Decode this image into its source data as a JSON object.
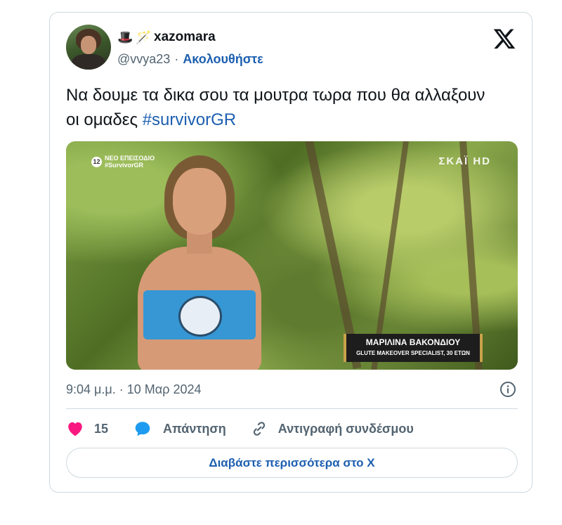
{
  "author": {
    "emoji_1": "🎩",
    "emoji_2": "🪄",
    "display_name": "xazomara",
    "handle": "@vvya23",
    "separator": "·",
    "follow_label": "Ακολουθήστε"
  },
  "tweet": {
    "text": "Να δουμε τα δικα σου τα μουτρα τωρα που θα αλλαξουν οι ομαδες ",
    "hashtag": "#survivorGR"
  },
  "media": {
    "tv_badge_number": "12",
    "tv_badge_line1": "ΝΕΟ ΕΠΕΙΣΟΔΙΟ",
    "tv_badge_line2": "#SurvivorGR",
    "channel_logo": "ΣΚΑΪ HD",
    "caption_name": "ΜΑΡΙΛΙΝΑ ΒΑΚΟΝΔΙΟΥ",
    "caption_sub": "GLUTE MAKEOVER SPECIALIST, 30 ΕΤΩΝ"
  },
  "meta": {
    "timestamp": "9:04 μ.μ. · 10 Μαρ 2024"
  },
  "actions": {
    "like_count": "15",
    "reply_label": "Απάντηση",
    "copy_link_label": "Αντιγραφή συνδέσμου"
  },
  "footer": {
    "read_more_label": "Διαβάστε περισσότερα στο X"
  },
  "colors": {
    "link": "#1d5fb0",
    "like": "#f91880",
    "reply": "#1d9bf0",
    "muted": "#536471",
    "border": "#cfd9de"
  },
  "icons": [
    "x-logo-icon",
    "info-icon",
    "heart-icon",
    "reply-bubble-icon",
    "link-icon"
  ]
}
